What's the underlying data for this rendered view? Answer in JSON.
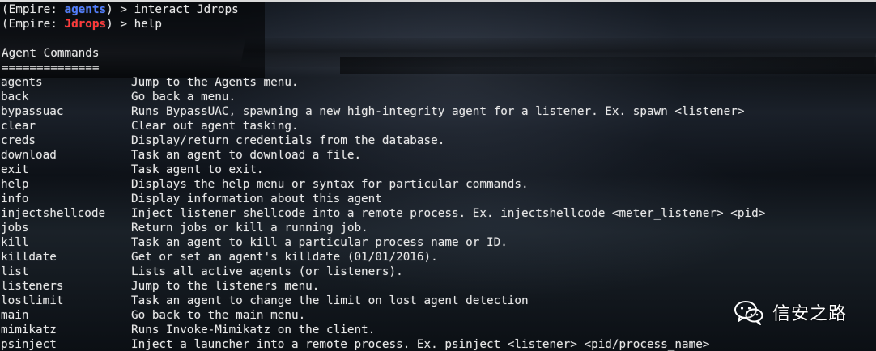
{
  "terminal": {
    "prompt_lines": [
      {
        "prefix": "(Empire: ",
        "agent": "agents",
        "suffix": ") > ",
        "command": "interact Jdrops"
      },
      {
        "prefix": "(Empire: ",
        "agent": "Jdrops",
        "suffix": ") > ",
        "command": "help"
      }
    ],
    "section_title": "Agent Commands",
    "section_rule": "==============",
    "commands": [
      {
        "name": "agents",
        "description": "Jump to the Agents menu."
      },
      {
        "name": "back",
        "description": "Go back a menu."
      },
      {
        "name": "bypassuac",
        "description": "Runs BypassUAC, spawning a new high-integrity agent for a listener. Ex. spawn <listener>"
      },
      {
        "name": "clear",
        "description": "Clear out agent tasking."
      },
      {
        "name": "creds",
        "description": "Display/return credentials from the database."
      },
      {
        "name": "download",
        "description": "Task an agent to download a file."
      },
      {
        "name": "exit",
        "description": "Task agent to exit."
      },
      {
        "name": "help",
        "description": "Displays the help menu or syntax for particular commands."
      },
      {
        "name": "info",
        "description": "Display information about this agent"
      },
      {
        "name": "injectshellcode",
        "description": "Inject listener shellcode into a remote process. Ex. injectshellcode <meter_listener> <pid>"
      },
      {
        "name": "jobs",
        "description": "Return jobs or kill a running job."
      },
      {
        "name": "kill",
        "description": "Task an agent to kill a particular process name or ID."
      },
      {
        "name": "killdate",
        "description": "Get or set an agent's killdate (01/01/2016)."
      },
      {
        "name": "list",
        "description": "Lists all active agents (or listeners)."
      },
      {
        "name": "listeners",
        "description": "Jump to the listeners menu."
      },
      {
        "name": "lostlimit",
        "description": "Task an agent to change the limit on lost agent detection"
      },
      {
        "name": "main",
        "description": "Go back to the main menu."
      },
      {
        "name": "mimikatz",
        "description": "Runs Invoke-Mimikatz on the client."
      },
      {
        "name": "psinject",
        "description": "Inject a launcher into a remote process. Ex. psinject <listener> <pid/process_name>"
      }
    ]
  },
  "watermark": {
    "text": "信安之路",
    "icon": "wechat-icon"
  },
  "colors": {
    "agents_highlight": "#4f7cff",
    "jdrops_highlight": "#ff3838",
    "terminal_text": "#e7e7e7"
  }
}
